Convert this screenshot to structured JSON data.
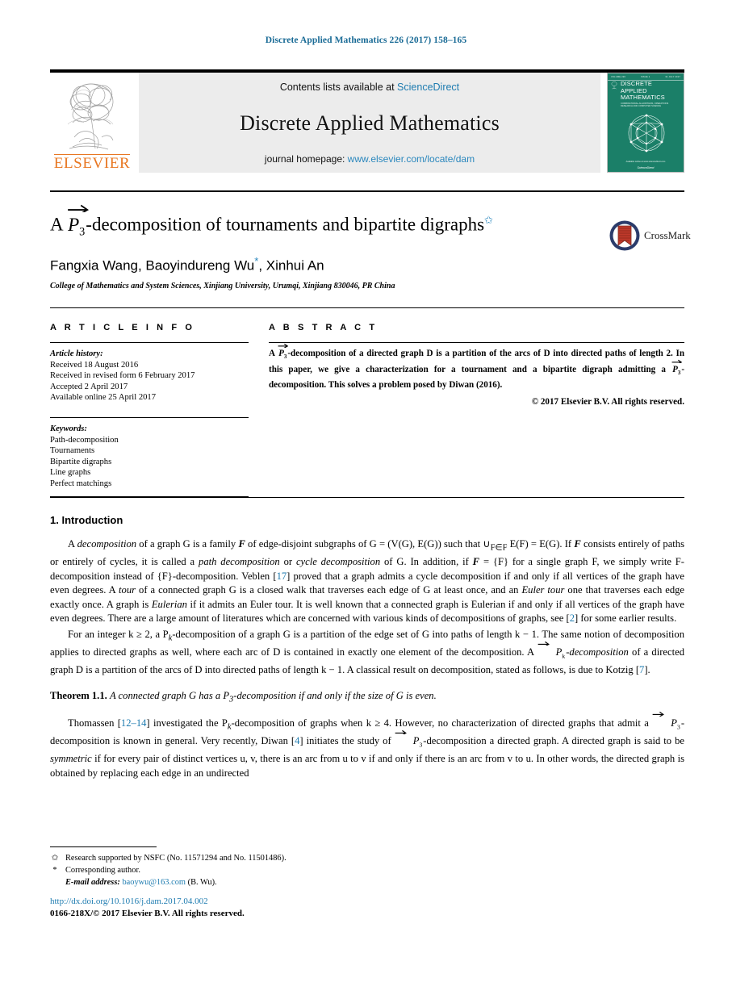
{
  "running_head": "Discrete Applied Mathematics 226 (2017) 158–165",
  "colors": {
    "link_blue": "#1d7bb0",
    "head_blue": "#1a6b96",
    "elsevier_orange": "#e87722",
    "cover_green": "#1b7f68",
    "band_grey": "#ececec"
  },
  "masthead": {
    "contents_prefix": "Contents lists available at",
    "sciencedirect": "ScienceDirect",
    "journal_name": "Discrete Applied Mathematics",
    "homepage_prefix": "journal homepage:",
    "homepage_url": "www.elsevier.com/locate/dam",
    "publisher_wordmark": "ELSEVIER",
    "cover": {
      "top_left": "VOLUME 226",
      "top_mid": "ISSUE 1",
      "top_right": "31 JULY 2017",
      "title_line1": "DISCRETE",
      "title_line2": "APPLIED",
      "title_line3": "MATHEMATICS",
      "subtitle": "COMBINATORIAL ALGORITHMS, OPERATIONS RESEARCH AND COMPUTER SCIENCE",
      "foot": "Available online at www.sciencedirect.com",
      "sd_word": "ScienceDirect"
    }
  },
  "article": {
    "title_prefix": "A",
    "title_math": "P",
    "title_math_sub": "3",
    "title_suffix": "-decomposition of tournaments and bipartite digraphs",
    "title_footnote_mark": "✩",
    "authors": "Fangxia Wang, Baoyindureng Wu",
    "authors_tail": ", Xinhui An",
    "corresponding_mark": "*",
    "affiliation": "College of Mathematics and System Sciences, Xinjiang University, Urumqi, Xinjiang 830046, PR China",
    "crossmark_label": "CrossMark"
  },
  "article_info": {
    "heading": "A R T I C L E   I N F O",
    "history_label": "Article history:",
    "history": [
      "Received 18 August 2016",
      "Received in revised form 6 February 2017",
      "Accepted 2 April 2017",
      "Available online 25 April 2017"
    ],
    "keywords_label": "Keywords:",
    "keywords": [
      "Path-decomposition",
      "Tournaments",
      "Bipartite digraphs",
      "Line graphs",
      "Perfect matchings"
    ]
  },
  "abstract": {
    "heading": "A B S T R A C T",
    "part1": "A",
    "math1": "P",
    "math1_sub": "3",
    "part2": "-decomposition of a directed graph D is a partition of the arcs of D into directed paths of length 2. In this paper, we give a characterization for a tournament and a bipartite digraph admitting a",
    "math2": "P",
    "math2_sub": "3",
    "part3": "-decomposition. This solves a problem posed by Diwan (2016).",
    "copyright": "© 2017 Elsevier B.V. All rights reserved."
  },
  "body": {
    "section_number": "1.",
    "section_title": "Introduction",
    "p1_a": "A ",
    "p1_decomp": "decomposition",
    "p1_b": " of a graph G is a family ",
    "p1_F1": "F",
    "p1_c": " of edge-disjoint subgraphs of G = (V(G), E(G)) such that ∪",
    "p1_sub": "F∈F",
    "p1_d": " E(F) = E(G). If ",
    "p1_F2": "F",
    "p1_e": " consists entirely of paths or entirely of cycles, it is called a ",
    "p1_pathdecomp": "path decomposition",
    "p1_f": " or ",
    "p1_cycledecomp": "cycle decomposition",
    "p1_g": " of G. In addition, if ",
    "p1_F3": "F",
    "p1_h": " = {F} for a single graph F, we simply write F-decomposition instead of {F}-decomposition. Veblen [",
    "p1_ref17": "17",
    "p1_i": "] proved that a graph admits a cycle decomposition if and only if all vertices of the graph have even degrees. A ",
    "p1_tour": "tour",
    "p1_j": " of a connected graph G is a closed walk that traverses each edge of G at least once, and an ",
    "p1_eulertour": "Euler tour",
    "p1_k": " one that traverses each edge exactly once. A graph is ",
    "p1_eulerian": "Eulerian",
    "p1_l": " if it admits an Euler tour. It is well known that a connected graph is Eulerian if and only if all vertices of the graph have even degrees. There are a large amount of literatures which are concerned with various kinds of decompositions of graphs, see [",
    "p1_ref2": "2",
    "p1_m": "] for some earlier results.",
    "p2_a": "For an integer k ≥ 2, a P",
    "p2_sub1": "k",
    "p2_b": "-decomposition of a graph G is a partition of the edge set of G into paths of length k − 1. The same notion of decomposition applies to directed graphs as well, where each arc of D is contained in exactly one element of the decomposition. A ",
    "p2_math": "P",
    "p2_math_sub": "k",
    "p2_c": "-decomposition",
    "p2_d": " of a directed graph D is a partition of the arcs of D into directed paths of length k − 1. A classical result on decomposition, stated as follows, is due to Kotzig [",
    "p2_ref7": "7",
    "p2_e": "].",
    "theorem_name": "Theorem 1.1.",
    "theorem_body_a": "A connected graph G has a P",
    "theorem_body_sub": "3",
    "theorem_body_b": "-decomposition if and only if the size of G is even.",
    "p3_a": "Thomassen [",
    "p3_ref1214": "12–14",
    "p3_b": "] investigated the P",
    "p3_sub1": "k",
    "p3_c": "-decomposition of graphs when k ≥ 4. However, no characterization of directed graphs that admit a ",
    "p3_math1": "P",
    "p3_math1_sub": "3",
    "p3_d": "-decomposition is known in general. Very recently, Diwan [",
    "p3_ref4": "4",
    "p3_e": "] initiates the study of ",
    "p3_math2": "P",
    "p3_math2_sub": "3",
    "p3_f": "-decomposition a directed graph. A directed graph is said to be ",
    "p3_symmetric": "symmetric",
    "p3_g": " if for every pair of distinct vertices u, v, there is an arc from u to v if and only if there is an arc from v to u. In other words, the directed graph is obtained by replacing each edge in an undirected"
  },
  "footnotes": {
    "mark_open": "✩",
    "funding": "Research supported by NSFC (No. 11571294 and No. 11501486).",
    "mark_star": "*",
    "corresponding": "Corresponding author.",
    "email_label": "E-mail address:",
    "email": "baoywu@163.com",
    "email_owner": "(B. Wu).",
    "doi": "http://dx.doi.org/10.1016/j.dam.2017.04.002",
    "issn": "0166-218X/© 2017 Elsevier B.V. All rights reserved."
  }
}
